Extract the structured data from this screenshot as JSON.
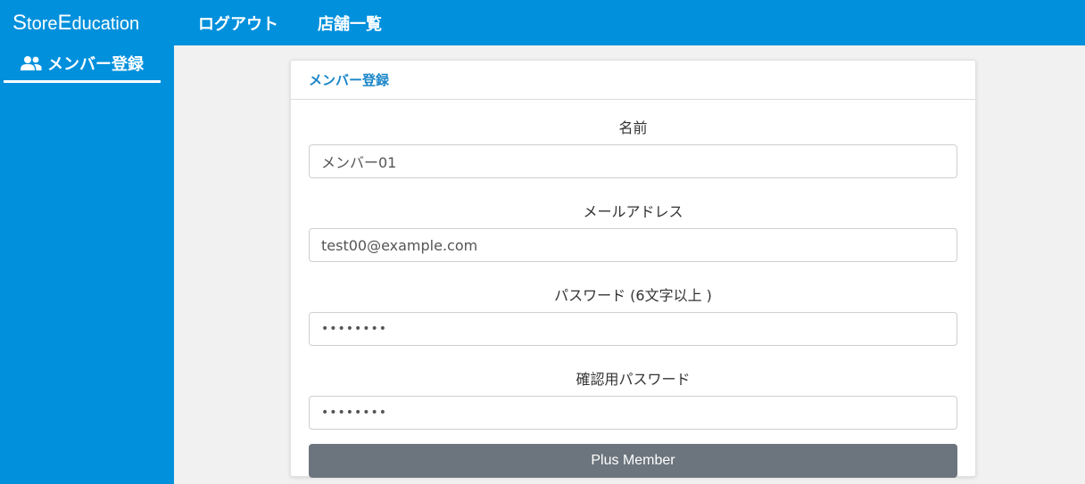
{
  "topbar": {
    "brand_s": "S",
    "brand_tore": "tore",
    "brand_e": "E",
    "brand_ducation": "ducation",
    "nav": [
      "ログアウト",
      "店舗一覧"
    ]
  },
  "sidebar": {
    "items": [
      {
        "icon": "users-icon",
        "label": "メンバー登録",
        "active": true
      }
    ]
  },
  "card": {
    "title": "メンバー登録",
    "fields": [
      {
        "label": "名前",
        "value": "メンバー01",
        "type": "text"
      },
      {
        "label": "メールアドレス",
        "value": "test00@example.com",
        "type": "email"
      },
      {
        "label": "パスワード (6文字以上 )",
        "value": "••••••••",
        "type": "password"
      },
      {
        "label": "確認用パスワード",
        "value": "••••••••",
        "type": "password"
      }
    ],
    "submit_label": "Plus Member"
  },
  "colors": {
    "primary": "#0090dc",
    "header_text": "#1a86c8",
    "button": "#6c757d",
    "background": "#f1f1f1"
  }
}
